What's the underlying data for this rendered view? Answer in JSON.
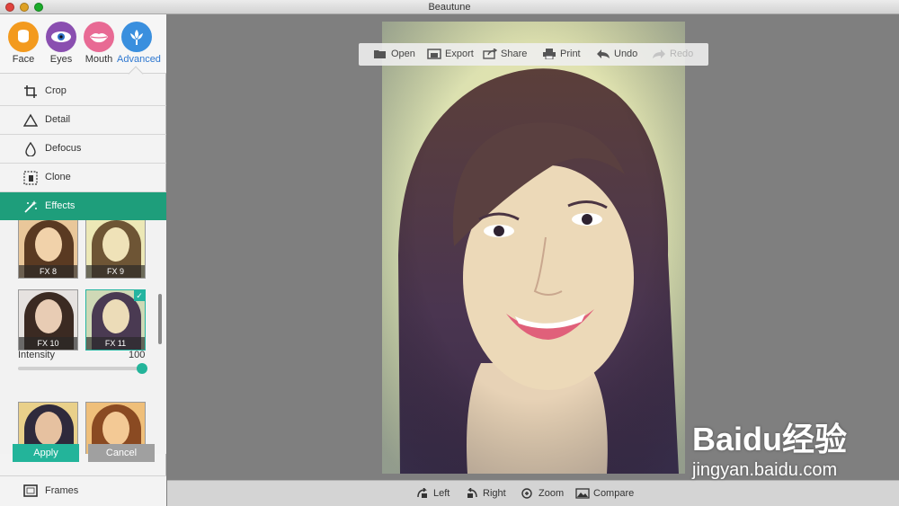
{
  "window": {
    "title": "Beautune"
  },
  "tabs": [
    {
      "label": "Face",
      "color": "#f39a1e",
      "icon": "face-icon"
    },
    {
      "label": "Eyes",
      "color": "#8a4fb0",
      "icon": "eye-icon"
    },
    {
      "label": "Mouth",
      "color": "#e86a94",
      "icon": "lips-icon"
    },
    {
      "label": "Advanced",
      "color": "#3a8fde",
      "icon": "flower-icon",
      "active": true
    }
  ],
  "tools": [
    {
      "label": "Crop",
      "icon": "crop-icon"
    },
    {
      "label": "Detail",
      "icon": "triangle-icon"
    },
    {
      "label": "Defocus",
      "icon": "drop-icon"
    },
    {
      "label": "Clone",
      "icon": "clone-icon"
    },
    {
      "label": "Effects",
      "icon": "magic-wand-icon",
      "active": true
    }
  ],
  "effects": [
    {
      "label": "FX 8"
    },
    {
      "label": "FX 9"
    },
    {
      "label": "FX 10"
    },
    {
      "label": "FX 11",
      "selected": true
    }
  ],
  "intensity": {
    "label": "Intensity",
    "value": "100",
    "fraction": 1.0
  },
  "actions": {
    "apply": "Apply",
    "cancel": "Cancel"
  },
  "frames": {
    "label": "Frames"
  },
  "toolbar": {
    "open": "Open",
    "export": "Export",
    "share": "Share",
    "print": "Print",
    "undo": "Undo",
    "redo": "Redo"
  },
  "bottombar": {
    "left": "Left",
    "right": "Right",
    "zoom": "Zoom",
    "compare": "Compare"
  },
  "watermark": {
    "main": "Baidu经验",
    "sub": "jingyan.baidu.com"
  },
  "colors": {
    "accent": "#1e9e7b",
    "apply": "#23b49a",
    "advanced": "#3a8fde"
  }
}
